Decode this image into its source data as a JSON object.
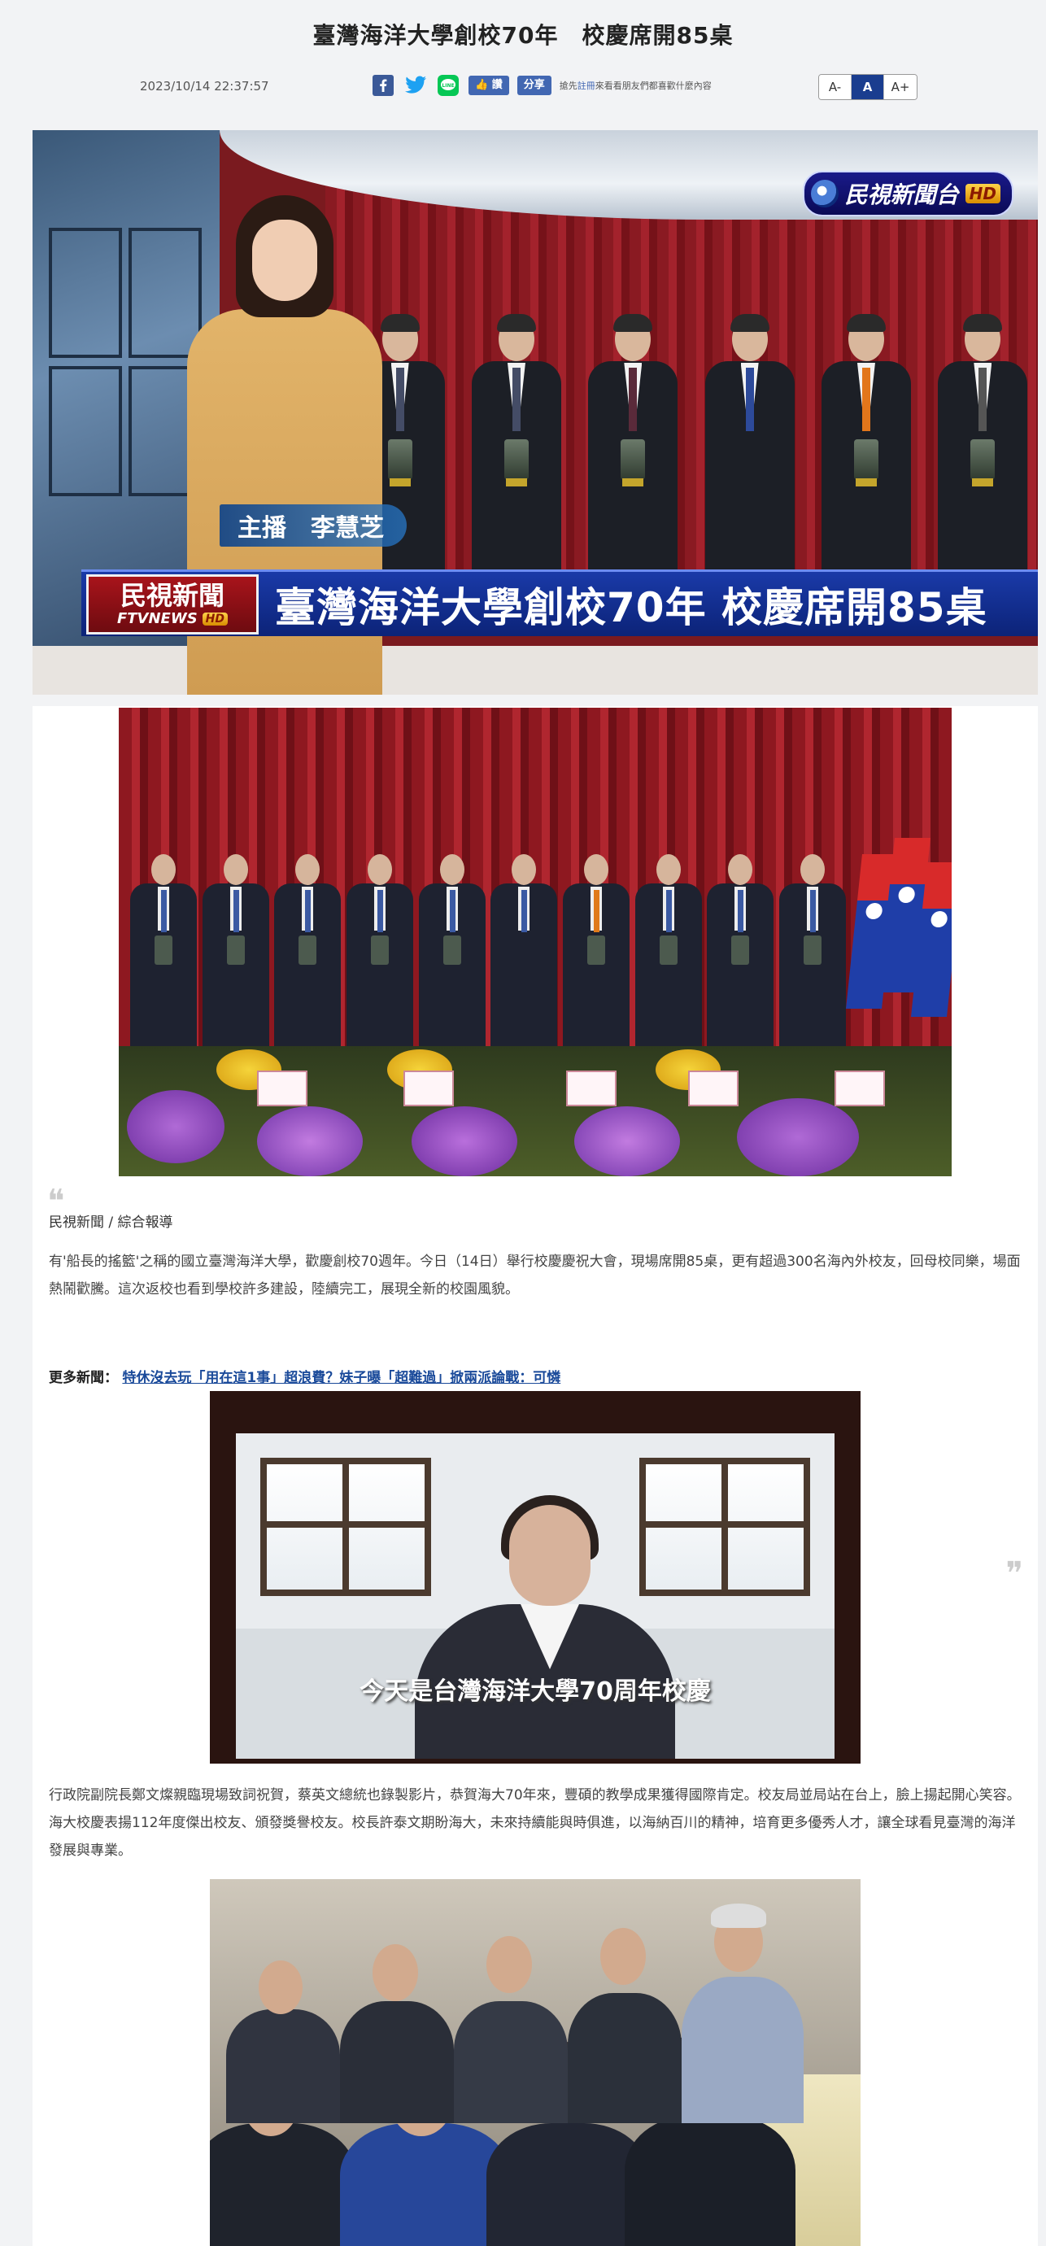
{
  "article": {
    "title": "臺灣海洋大學創校70年　校慶席開85桌",
    "datetime": "2023/10/14 22:37:57",
    "source": "民視新聞 / 綜合報導",
    "paragraph_1": "有'船長的搖籃'之稱的國立臺灣海洋大學，歡慶創校70週年。今日（14日）舉行校慶慶祝大會，現場席開85桌，更有超過300名海內外校友，回母校同樂，場面熱鬧歡騰。這次返校也看到學校許多建設，陸續完工，展現全新的校園風貌。",
    "paragraph_2": "行政院副院長鄭文燦親臨現場致詞祝賀，蔡英文總統也錄製影片，恭賀海大70年來，豐碩的教學成果獲得國際肯定。校友局並局站在台上，臉上揚起開心笑容。海大校慶表揚112年度傑出校友、頒發獎譽校友。校長許泰文期盼海大，未來持續能與時俱進，以海納百川的精神，培育更多優秀人才，讓全球看見臺灣的海洋發展與專業。",
    "more_news_label": "更多新聞：",
    "more_news_link": "特休沒去玩「用在這1事」超浪費？妹子曝「超難過」掀兩派論戰：可憐"
  },
  "share": {
    "icons": [
      "facebook-icon",
      "twitter-icon",
      "line-icon"
    ],
    "fb_like_label": "👍 讚",
    "fb_share_label": "分享",
    "hint_prefix": "搶先",
    "hint_link": "註冊",
    "hint_suffix": "來看看朋友們都喜歡什麼內容"
  },
  "font_size": {
    "options": [
      "A-",
      "A",
      "A+"
    ],
    "selected": "A"
  },
  "video": {
    "channel_logo": "民視新聞台",
    "hd_badge": "HD",
    "anchor_label": "主播　李慧芝",
    "ticker_logo_top": "民視新聞",
    "ticker_logo_bottom": "FTVNEWS",
    "ticker_hd": "HD",
    "headline": "臺灣海洋大學創校70年 校慶席開85桌"
  },
  "photos": {
    "projector_subtitle": "今天是台灣海洋大學70周年校慶"
  },
  "colors": {
    "accent": "#1a3d8f",
    "link": "#1a4a9a",
    "fb_blue": "#4267b2",
    "twitter_blue": "#1da1f2",
    "line_green": "#06c755"
  }
}
